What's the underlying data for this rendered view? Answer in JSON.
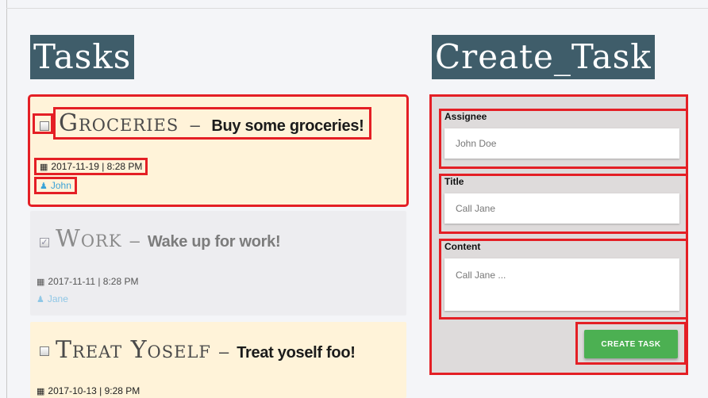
{
  "left_heading": "Tasks",
  "right_heading": "Create_Task",
  "tasks": [
    {
      "title": "Groceries",
      "separator": "–",
      "content": "Buy some groceries!",
      "date": "2017-11-19 | 8:28 PM",
      "assignee": "John",
      "completed": false
    },
    {
      "title": "Work",
      "separator": "–",
      "content": "Wake up for work!",
      "date": "2017-11-11 | 8:28 PM",
      "assignee": "Jane",
      "completed": true
    },
    {
      "title": "Treat Yoself",
      "separator": "–",
      "content": "Treat yoself foo!",
      "date": "2017-10-13 | 9:28 PM",
      "completed": false
    }
  ],
  "form": {
    "assignee": {
      "label": "Assignee",
      "placeholder": "John Doe"
    },
    "title": {
      "label": "Title",
      "placeholder": "Call Jane"
    },
    "content": {
      "label": "Content",
      "placeholder": "Call Jane ..."
    },
    "submit_label": "CREATE TASK"
  },
  "icons": {
    "checkbox": "checkbox-icon",
    "date": "calendar-icon",
    "user": "user-icon"
  },
  "colors": {
    "heading_bg": "#3f5d6a",
    "pending_bg": "#fff3d9",
    "done_bg": "#ededf0",
    "form_bg": "#dedbdb",
    "button": "#4cb052",
    "assignee_link": "#3aa3d8",
    "highlight": "#e41f25"
  }
}
